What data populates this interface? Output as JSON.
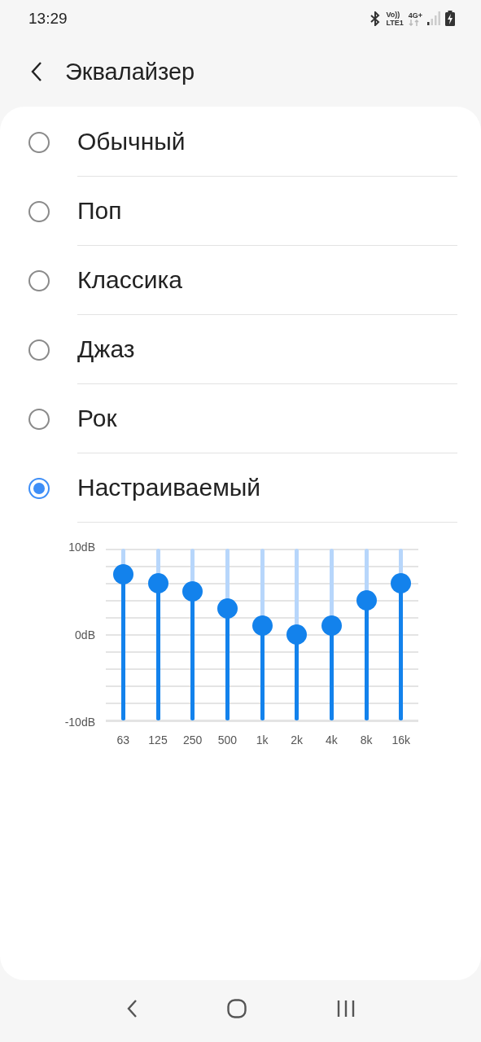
{
  "status_bar": {
    "time": "13:29",
    "volte": "Vo))",
    "lte": "LTE1",
    "network": "4G+"
  },
  "header": {
    "title": "Эквалайзер"
  },
  "presets": [
    {
      "label": "Обычный",
      "selected": false
    },
    {
      "label": "Поп",
      "selected": false
    },
    {
      "label": "Классика",
      "selected": false
    },
    {
      "label": "Джаз",
      "selected": false
    },
    {
      "label": "Рок",
      "selected": false
    },
    {
      "label": "Настраиваемый",
      "selected": true
    }
  ],
  "equalizer": {
    "scale": [
      "10dB",
      "0dB",
      "-10dB"
    ],
    "bands": [
      {
        "label": "63",
        "level": 0.85
      },
      {
        "label": "125",
        "level": 0.8
      },
      {
        "label": "250",
        "level": 0.75
      },
      {
        "label": "500",
        "level": 0.65
      },
      {
        "label": "1k",
        "level": 0.55
      },
      {
        "label": "2k",
        "level": 0.5
      },
      {
        "label": "4k",
        "level": 0.55
      },
      {
        "label": "8k",
        "level": 0.7
      },
      {
        "label": "16k",
        "level": 0.8
      }
    ]
  }
}
